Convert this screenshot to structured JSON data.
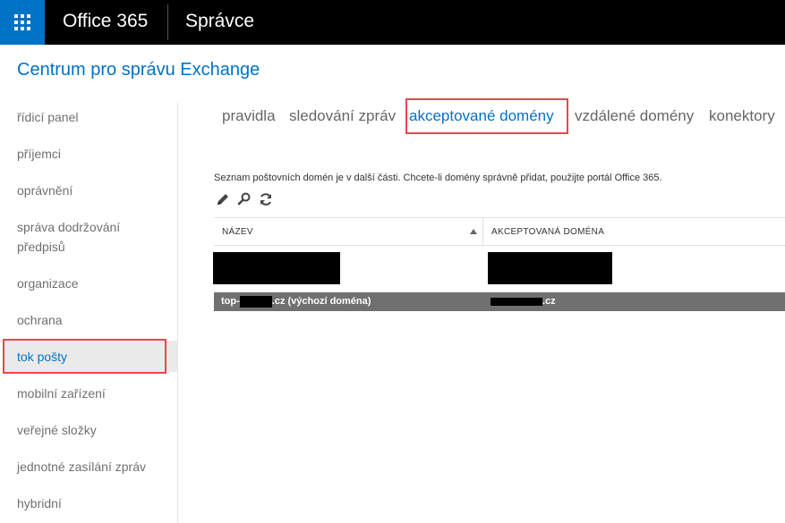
{
  "topbar": {
    "brand": "Office 365",
    "app": "Správce"
  },
  "page": {
    "title": "Centrum pro správu Exchange"
  },
  "sidebar": {
    "items": [
      {
        "label": "řídicí panel"
      },
      {
        "label": "příjemci"
      },
      {
        "label": "oprávnění"
      },
      {
        "label": "správa dodržování předpisů"
      },
      {
        "label": "organizace"
      },
      {
        "label": "ochrana"
      },
      {
        "label": "tok pošty",
        "active": true
      },
      {
        "label": "mobilní zařízení"
      },
      {
        "label": "veřejné složky"
      },
      {
        "label": "jednotné zasílání zpráv"
      },
      {
        "label": "hybridní"
      }
    ]
  },
  "tabs": [
    {
      "label": "pravidla"
    },
    {
      "label": "sledování zpráv"
    },
    {
      "label": "akceptované domény",
      "active": true
    },
    {
      "label": "vzdálené domény"
    },
    {
      "label": "konektory"
    }
  ],
  "content": {
    "description": "Seznam poštovních domén je v další části. Chcete-li domény správně přidat, použijte portál Office 365.",
    "toolbar": [
      "pencil-icon",
      "search-icon",
      "refresh-icon"
    ],
    "table": {
      "columns": [
        "NÁZEV",
        "AKCEPTOVANÁ DOMÉNA"
      ],
      "rows": [
        {
          "name_prefix": "top-",
          "name_suffix": ".cz (výchozí doména)",
          "domain_suffix": ".cz",
          "selected": true
        }
      ]
    }
  },
  "colors": {
    "accent": "#0072c6",
    "highlight": "#e8474c",
    "topbar": "#000000",
    "selected_row": "#707070"
  }
}
